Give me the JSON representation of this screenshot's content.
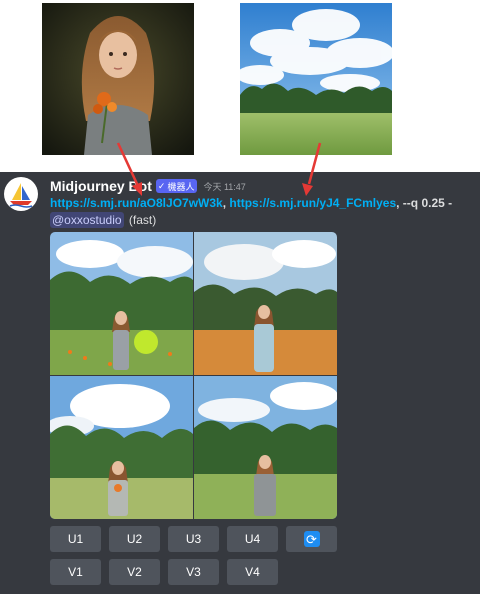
{
  "message": {
    "bot_name": "Midjourney Bot",
    "bot_badge": "機器人",
    "timestamp": "今天 11:47",
    "links": [
      "https://s.mj.run/aO8lJO7wW3k",
      "https://s.mj.run/yJ4_FCmlyes"
    ],
    "comma": ",",
    "params": ", --q 0.25 -",
    "mention": "@oxxostudio",
    "speed": "(fast)"
  },
  "buttons": {
    "upscale": [
      "U1",
      "U2",
      "U3",
      "U4"
    ],
    "variation": [
      "V1",
      "V2",
      "V3",
      "V4"
    ],
    "reroll_icon": "refresh-icon"
  },
  "colors": {
    "panel_bg": "#36393f",
    "link": "#00aff4",
    "badge": "#5865f2",
    "button": "#4f545c",
    "reroll": "#1e8df2",
    "arrow": "#e53935"
  }
}
